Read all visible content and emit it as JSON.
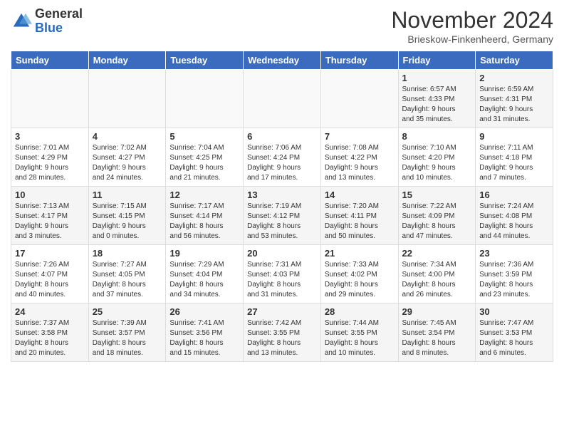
{
  "logo": {
    "general": "General",
    "blue": "Blue"
  },
  "header": {
    "month": "November 2024",
    "location": "Brieskow-Finkenheerd, Germany"
  },
  "weekdays": [
    "Sunday",
    "Monday",
    "Tuesday",
    "Wednesday",
    "Thursday",
    "Friday",
    "Saturday"
  ],
  "weeks": [
    [
      {
        "day": "",
        "info": ""
      },
      {
        "day": "",
        "info": ""
      },
      {
        "day": "",
        "info": ""
      },
      {
        "day": "",
        "info": ""
      },
      {
        "day": "",
        "info": ""
      },
      {
        "day": "1",
        "info": "Sunrise: 6:57 AM\nSunset: 4:33 PM\nDaylight: 9 hours\nand 35 minutes."
      },
      {
        "day": "2",
        "info": "Sunrise: 6:59 AM\nSunset: 4:31 PM\nDaylight: 9 hours\nand 31 minutes."
      }
    ],
    [
      {
        "day": "3",
        "info": "Sunrise: 7:01 AM\nSunset: 4:29 PM\nDaylight: 9 hours\nand 28 minutes."
      },
      {
        "day": "4",
        "info": "Sunrise: 7:02 AM\nSunset: 4:27 PM\nDaylight: 9 hours\nand 24 minutes."
      },
      {
        "day": "5",
        "info": "Sunrise: 7:04 AM\nSunset: 4:25 PM\nDaylight: 9 hours\nand 21 minutes."
      },
      {
        "day": "6",
        "info": "Sunrise: 7:06 AM\nSunset: 4:24 PM\nDaylight: 9 hours\nand 17 minutes."
      },
      {
        "day": "7",
        "info": "Sunrise: 7:08 AM\nSunset: 4:22 PM\nDaylight: 9 hours\nand 13 minutes."
      },
      {
        "day": "8",
        "info": "Sunrise: 7:10 AM\nSunset: 4:20 PM\nDaylight: 9 hours\nand 10 minutes."
      },
      {
        "day": "9",
        "info": "Sunrise: 7:11 AM\nSunset: 4:18 PM\nDaylight: 9 hours\nand 7 minutes."
      }
    ],
    [
      {
        "day": "10",
        "info": "Sunrise: 7:13 AM\nSunset: 4:17 PM\nDaylight: 9 hours\nand 3 minutes."
      },
      {
        "day": "11",
        "info": "Sunrise: 7:15 AM\nSunset: 4:15 PM\nDaylight: 9 hours\nand 0 minutes."
      },
      {
        "day": "12",
        "info": "Sunrise: 7:17 AM\nSunset: 4:14 PM\nDaylight: 8 hours\nand 56 minutes."
      },
      {
        "day": "13",
        "info": "Sunrise: 7:19 AM\nSunset: 4:12 PM\nDaylight: 8 hours\nand 53 minutes."
      },
      {
        "day": "14",
        "info": "Sunrise: 7:20 AM\nSunset: 4:11 PM\nDaylight: 8 hours\nand 50 minutes."
      },
      {
        "day": "15",
        "info": "Sunrise: 7:22 AM\nSunset: 4:09 PM\nDaylight: 8 hours\nand 47 minutes."
      },
      {
        "day": "16",
        "info": "Sunrise: 7:24 AM\nSunset: 4:08 PM\nDaylight: 8 hours\nand 44 minutes."
      }
    ],
    [
      {
        "day": "17",
        "info": "Sunrise: 7:26 AM\nSunset: 4:07 PM\nDaylight: 8 hours\nand 40 minutes."
      },
      {
        "day": "18",
        "info": "Sunrise: 7:27 AM\nSunset: 4:05 PM\nDaylight: 8 hours\nand 37 minutes."
      },
      {
        "day": "19",
        "info": "Sunrise: 7:29 AM\nSunset: 4:04 PM\nDaylight: 8 hours\nand 34 minutes."
      },
      {
        "day": "20",
        "info": "Sunrise: 7:31 AM\nSunset: 4:03 PM\nDaylight: 8 hours\nand 31 minutes."
      },
      {
        "day": "21",
        "info": "Sunrise: 7:33 AM\nSunset: 4:02 PM\nDaylight: 8 hours\nand 29 minutes."
      },
      {
        "day": "22",
        "info": "Sunrise: 7:34 AM\nSunset: 4:00 PM\nDaylight: 8 hours\nand 26 minutes."
      },
      {
        "day": "23",
        "info": "Sunrise: 7:36 AM\nSunset: 3:59 PM\nDaylight: 8 hours\nand 23 minutes."
      }
    ],
    [
      {
        "day": "24",
        "info": "Sunrise: 7:37 AM\nSunset: 3:58 PM\nDaylight: 8 hours\nand 20 minutes."
      },
      {
        "day": "25",
        "info": "Sunrise: 7:39 AM\nSunset: 3:57 PM\nDaylight: 8 hours\nand 18 minutes."
      },
      {
        "day": "26",
        "info": "Sunrise: 7:41 AM\nSunset: 3:56 PM\nDaylight: 8 hours\nand 15 minutes."
      },
      {
        "day": "27",
        "info": "Sunrise: 7:42 AM\nSunset: 3:55 PM\nDaylight: 8 hours\nand 13 minutes."
      },
      {
        "day": "28",
        "info": "Sunrise: 7:44 AM\nSunset: 3:55 PM\nDaylight: 8 hours\nand 10 minutes."
      },
      {
        "day": "29",
        "info": "Sunrise: 7:45 AM\nSunset: 3:54 PM\nDaylight: 8 hours\nand 8 minutes."
      },
      {
        "day": "30",
        "info": "Sunrise: 7:47 AM\nSunset: 3:53 PM\nDaylight: 8 hours\nand 6 minutes."
      }
    ]
  ]
}
